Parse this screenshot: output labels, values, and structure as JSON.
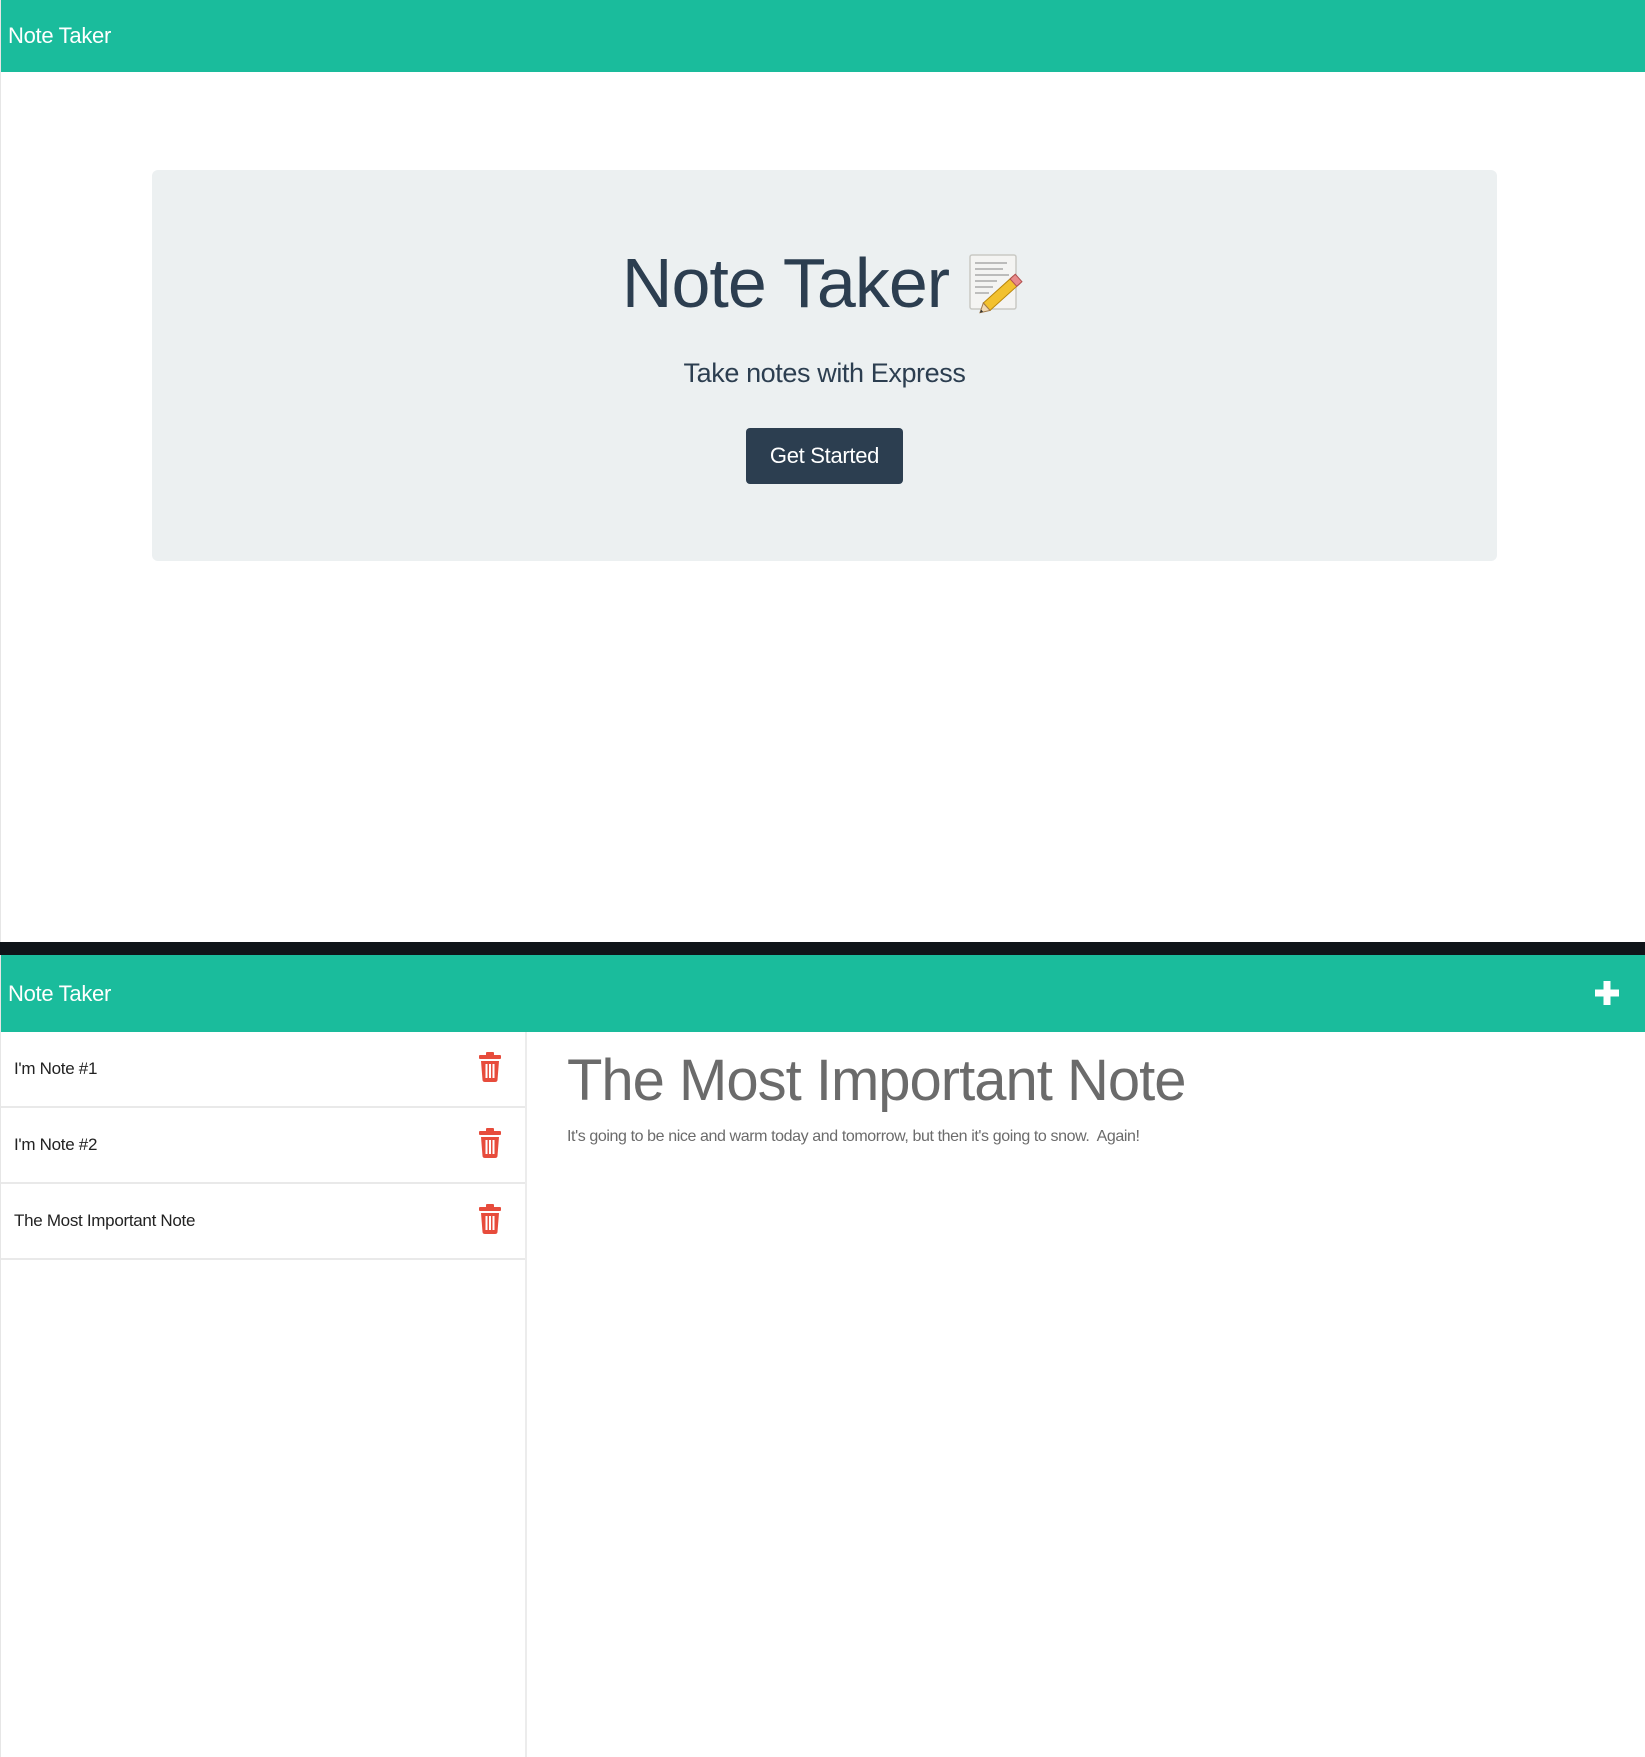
{
  "landing": {
    "navbar": {
      "brand": "Note Taker"
    },
    "hero": {
      "title": "Note Taker",
      "icon": "memo-pencil-icon",
      "subtitle": "Take notes with Express",
      "cta_label": "Get Started"
    }
  },
  "notes_page": {
    "navbar": {
      "brand": "Note Taker",
      "add_icon": "plus-icon"
    },
    "notes": [
      {
        "title": "I'm Note #1"
      },
      {
        "title": "I'm Note #2"
      },
      {
        "title": "The Most Important Note"
      }
    ],
    "active_note": {
      "title": "The Most Important Note",
      "body": "It's going to be nice and warm today and tomorrow, but then it's going to snow.  Again!"
    },
    "delete_icon": "trash-icon"
  },
  "colors": {
    "navbar": "#1abc9c",
    "jumbotron": "#ecf0f1",
    "button": "#2c3e50",
    "delete": "#e74c3c"
  }
}
